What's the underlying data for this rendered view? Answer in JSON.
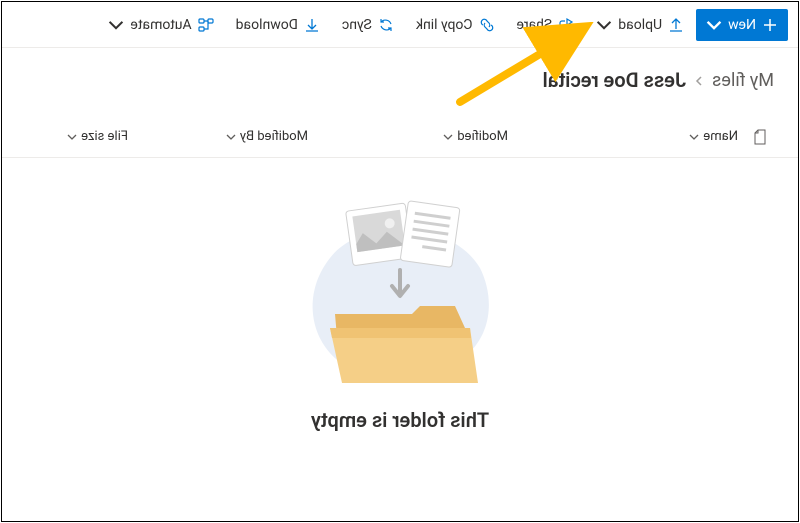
{
  "toolbar": {
    "new_label": "New",
    "upload_label": "Upload",
    "share_label": "Share",
    "copylink_label": "Copy link",
    "sync_label": "Sync",
    "download_label": "Download",
    "automate_label": "Automate"
  },
  "breadcrumb": {
    "root": "My files",
    "current": "Jess Doe recital"
  },
  "columns": {
    "name": "Name",
    "modified": "Modified",
    "modified_by": "Modified By",
    "file_size": "File size"
  },
  "empty": {
    "message": "This folder is empty"
  },
  "colors": {
    "primary": "#0078d4",
    "annotation": "#ffb900"
  }
}
